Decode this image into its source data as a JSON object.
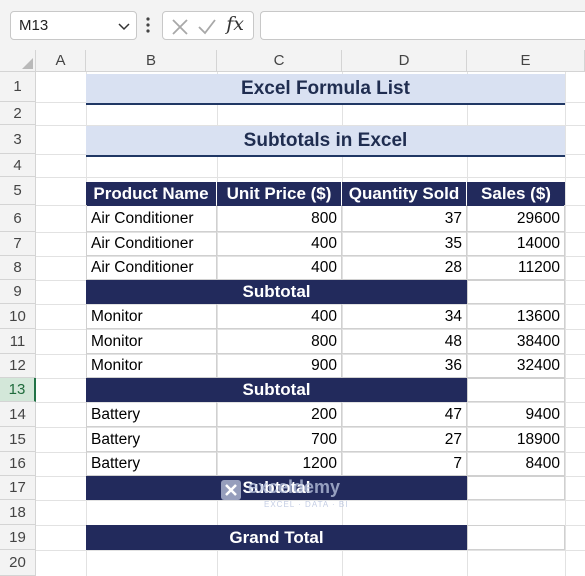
{
  "formula_bar": {
    "name_box": "M13",
    "fx_label": "fx",
    "formula": ""
  },
  "columns": [
    "A",
    "B",
    "C",
    "D",
    "E"
  ],
  "rows": [
    "1",
    "2",
    "3",
    "4",
    "5",
    "6",
    "7",
    "8",
    "9",
    "10",
    "11",
    "12",
    "13",
    "14",
    "15",
    "16",
    "17",
    "18",
    "19",
    "20"
  ],
  "active_row": "13",
  "sheet": {
    "title": "Excel Formula List",
    "subtitle": "Subtotals in Excel",
    "headers": [
      "Product Name",
      "Unit Price ($)",
      "Quantity Sold",
      "Sales ($)"
    ],
    "groups": [
      {
        "rows": [
          [
            "Air Conditioner",
            "800",
            "37",
            "29600"
          ],
          [
            "Air Conditioner",
            "400",
            "35",
            "14000"
          ],
          [
            "Air Conditioner",
            "400",
            "28",
            "11200"
          ]
        ],
        "subtotal_label": "Subtotal"
      },
      {
        "rows": [
          [
            "Monitor",
            "400",
            "34",
            "13600"
          ],
          [
            "Monitor",
            "800",
            "48",
            "38400"
          ],
          [
            "Monitor",
            "900",
            "36",
            "32400"
          ]
        ],
        "subtotal_label": "Subtotal"
      },
      {
        "rows": [
          [
            "Battery",
            "200",
            "47",
            "9400"
          ],
          [
            "Battery",
            "700",
            "27",
            "18900"
          ],
          [
            "Battery",
            "1200",
            "7",
            "8400"
          ]
        ],
        "subtotal_label": "Subtotal"
      }
    ],
    "grand_total_label": "Grand Total"
  },
  "watermark": {
    "name": "exceldemy",
    "tagline": "EXCEL · DATA · BI"
  },
  "colors": {
    "header_fill": "#222a5c",
    "title_fill": "#d9e1f2",
    "active_row": "#217346"
  }
}
